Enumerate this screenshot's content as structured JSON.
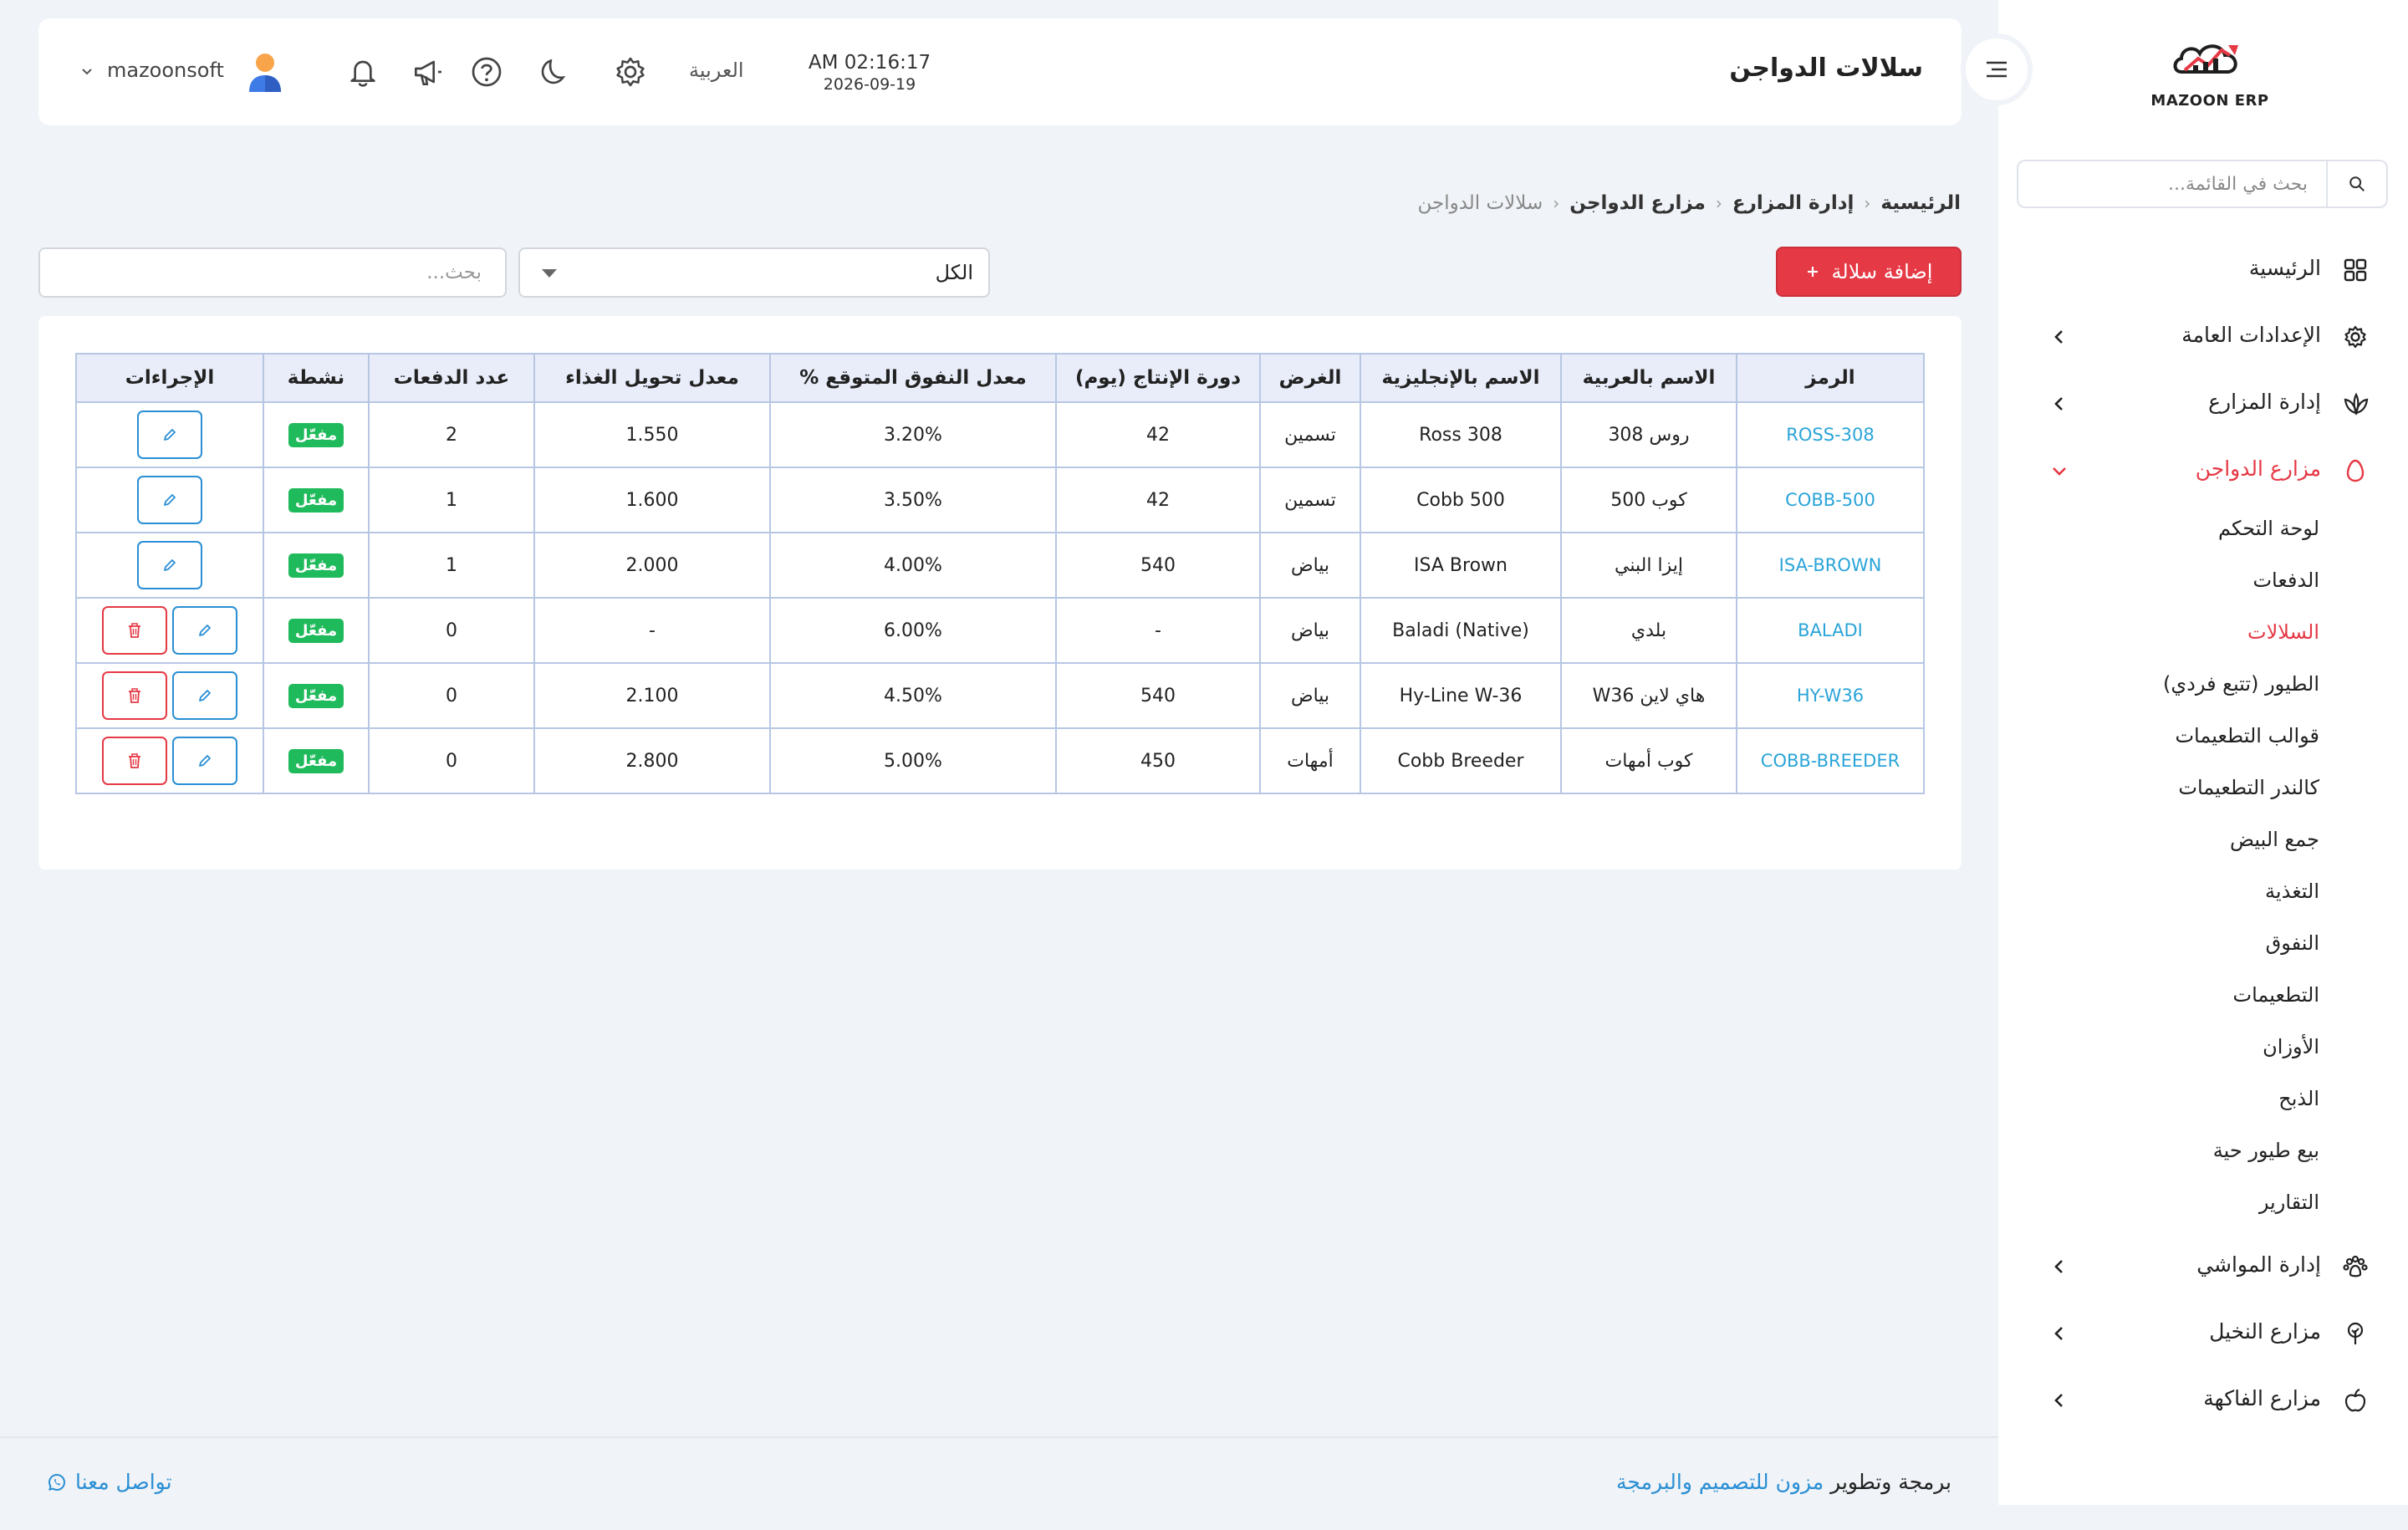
{
  "sidebar": {
    "logo_text": "MAZOON ERP",
    "search_placeholder": "بحث في القائمة...",
    "nav": [
      {
        "label": "الرئيسية"
      },
      {
        "label": "الإعدادات العامة"
      },
      {
        "label": "إدارة المزارع"
      },
      {
        "label": "مزارع الدواجن"
      },
      {
        "label": "إدارة المواشي"
      },
      {
        "label": "مزارع النخيل"
      },
      {
        "label": "مزارع الفاكهة"
      }
    ],
    "submenu": [
      "لوحة التحكم",
      "الدفعات",
      "السلالات",
      "الطيور (تتبع فردي)",
      "قوالب التطعيمات",
      "كالندر التطعيمات",
      "جمع البيض",
      "التغذية",
      "النفوق",
      "التطعيمات",
      "الأوزان",
      "الذبح",
      "بيع طيور حية",
      "التقارير"
    ]
  },
  "header": {
    "page_title": "سلالات الدواجن",
    "time": "AM 02:16:17",
    "date": "2026-09-19",
    "language": "العربية",
    "user_name": "mazoonsoft"
  },
  "breadcrumb": {
    "home": "الرئيسية",
    "farms": "إدارة المزارع",
    "poultry": "مزارع الدواجن",
    "current": "سلالات الدواجن"
  },
  "toolbar": {
    "add_label": "إضافة سلالة",
    "filter_value": "الكل",
    "search_placeholder": "بحث..."
  },
  "table": {
    "headers": {
      "code": "الرمز",
      "name_ar": "الاسم بالعربية",
      "name_en": "الاسم بالإنجليزية",
      "purpose": "الغرض",
      "cycle": "دورة الإنتاج (يوم)",
      "mortality": "معدل النفوق المتوقع %",
      "fcr": "معدل تحويل الغذاء",
      "batches": "عدد الدفعات",
      "active": "نشطة",
      "actions": "الإجراءات"
    },
    "rows": [
      {
        "code": "ROSS-308",
        "name_ar": "روس 308",
        "name_en": "Ross 308",
        "purpose": "تسمين",
        "cycle": "42",
        "mortality": "3.20%",
        "fcr": "1.550",
        "batches": "2",
        "status": "مفعّل"
      },
      {
        "code": "COBB-500",
        "name_ar": "كوب 500",
        "name_en": "Cobb 500",
        "purpose": "تسمين",
        "cycle": "42",
        "mortality": "3.50%",
        "fcr": "1.600",
        "batches": "1",
        "status": "مفعّل"
      },
      {
        "code": "ISA-BROWN",
        "name_ar": "إيزا البني",
        "name_en": "ISA Brown",
        "purpose": "بياض",
        "cycle": "540",
        "mortality": "4.00%",
        "fcr": "2.000",
        "batches": "1",
        "status": "مفعّل"
      },
      {
        "code": "BALADI",
        "name_ar": "بلدي",
        "name_en": "Baladi (Native)",
        "purpose": "بياض",
        "cycle": "-",
        "mortality": "6.00%",
        "fcr": "-",
        "batches": "0",
        "status": "مفعّل"
      },
      {
        "code": "HY-W36",
        "name_ar": "هاي لاين W36",
        "name_en": "Hy-Line W-36",
        "purpose": "بياض",
        "cycle": "540",
        "mortality": "4.50%",
        "fcr": "2.100",
        "batches": "0",
        "status": "مفعّل"
      },
      {
        "code": "COBB-BREEDER",
        "name_ar": "كوب أمهات",
        "name_en": "Cobb Breeder",
        "purpose": "أمهات",
        "cycle": "450",
        "mortality": "5.00%",
        "fcr": "2.800",
        "batches": "0",
        "status": "مفعّل"
      }
    ]
  },
  "footer": {
    "credit_prefix": "برمجة وتطوير",
    "credit_brand": "مزون للتصميم والبرمجة",
    "contact": "تواصل معنا"
  },
  "colors": {
    "accent_red": "#e53945",
    "link_blue": "#2a8fd4",
    "code_blue": "#2aa4d8",
    "badge_green": "#1fba5b",
    "header_row": "#e8edf9"
  },
  "icons": {
    "search": "search-icon",
    "grid": "grid-icon",
    "gear": "gear-icon",
    "leaf": "leaf-icon",
    "egg": "egg-icon",
    "paw": "paw-icon",
    "tree": "tree-icon",
    "apple": "apple-icon",
    "bell": "bell-icon",
    "megaphone": "megaphone-icon",
    "help": "help-icon",
    "moon": "moon-icon",
    "edit": "pencil-icon",
    "delete": "trash-icon",
    "whatsapp": "whatsapp-icon",
    "menu": "menu-icon"
  }
}
